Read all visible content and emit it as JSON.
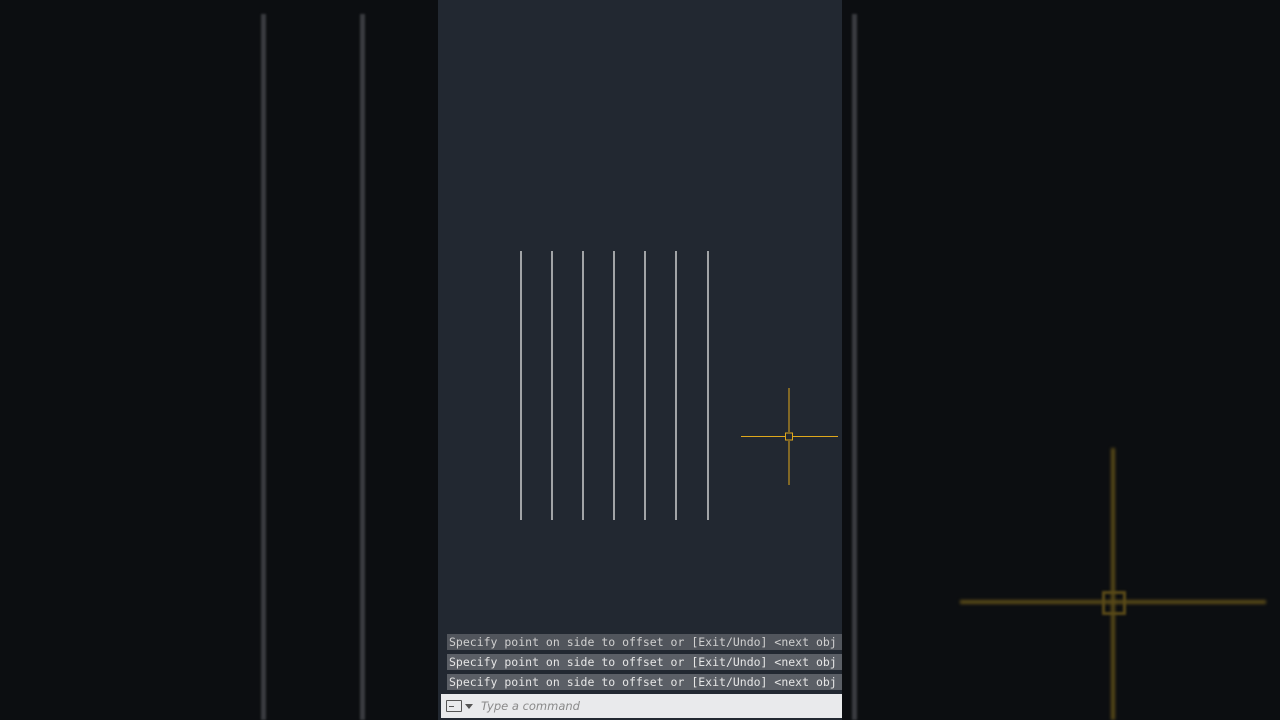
{
  "canvas": {
    "background": "#222831",
    "line_color": "#e6e6e6",
    "cursor_color": "#e0a81c"
  },
  "command_history": [
    "Specify point on side to offset or [Exit/Undo] <next obj",
    "Specify point on side to offset or [Exit/Undo] <next obj",
    "Specify point on side to offset or [Exit/Undo] <next obj"
  ],
  "command_input": {
    "placeholder": "Type a command",
    "value": ""
  },
  "icons": {
    "command_line": "command-line-icon",
    "dropdown": "chevron-down-icon",
    "cursor": "crosshair-cursor-icon"
  }
}
